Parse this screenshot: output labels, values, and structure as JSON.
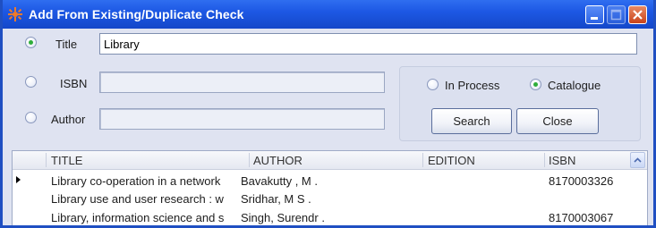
{
  "window": {
    "title": "Add From Existing/Duplicate Check",
    "icon": "app-star-icon",
    "colors": {
      "titlebar": "#1d58e4",
      "close": "#c9431b",
      "radio_checked": "#2fae3a"
    }
  },
  "search": {
    "title_label": "Title",
    "title_value": "Library",
    "title_selected": true,
    "isbn_label": "ISBN",
    "isbn_value": "",
    "author_label": "Author",
    "author_value": ""
  },
  "scope": {
    "in_process_label": "In Process",
    "catalogue_label": "Catalogue",
    "selected": "Catalogue"
  },
  "buttons": {
    "search_label": "Search",
    "close_label": "Close"
  },
  "grid": {
    "columns": [
      "TITLE",
      "AUTHOR",
      "EDITION",
      "ISBN"
    ],
    "rows": [
      {
        "title": "Library co-operation in a network",
        "author": "Bavakutty , M  .",
        "edition": "",
        "isbn": "8170003326",
        "current": true
      },
      {
        "title": "Library use and user research : w",
        "author": "Sridhar, M S  .",
        "edition": "",
        "isbn": "",
        "current": false
      },
      {
        "title": "Library, information science and s",
        "author": "Singh, Surendr .",
        "edition": "",
        "isbn": "8170003067",
        "current": false
      }
    ]
  }
}
